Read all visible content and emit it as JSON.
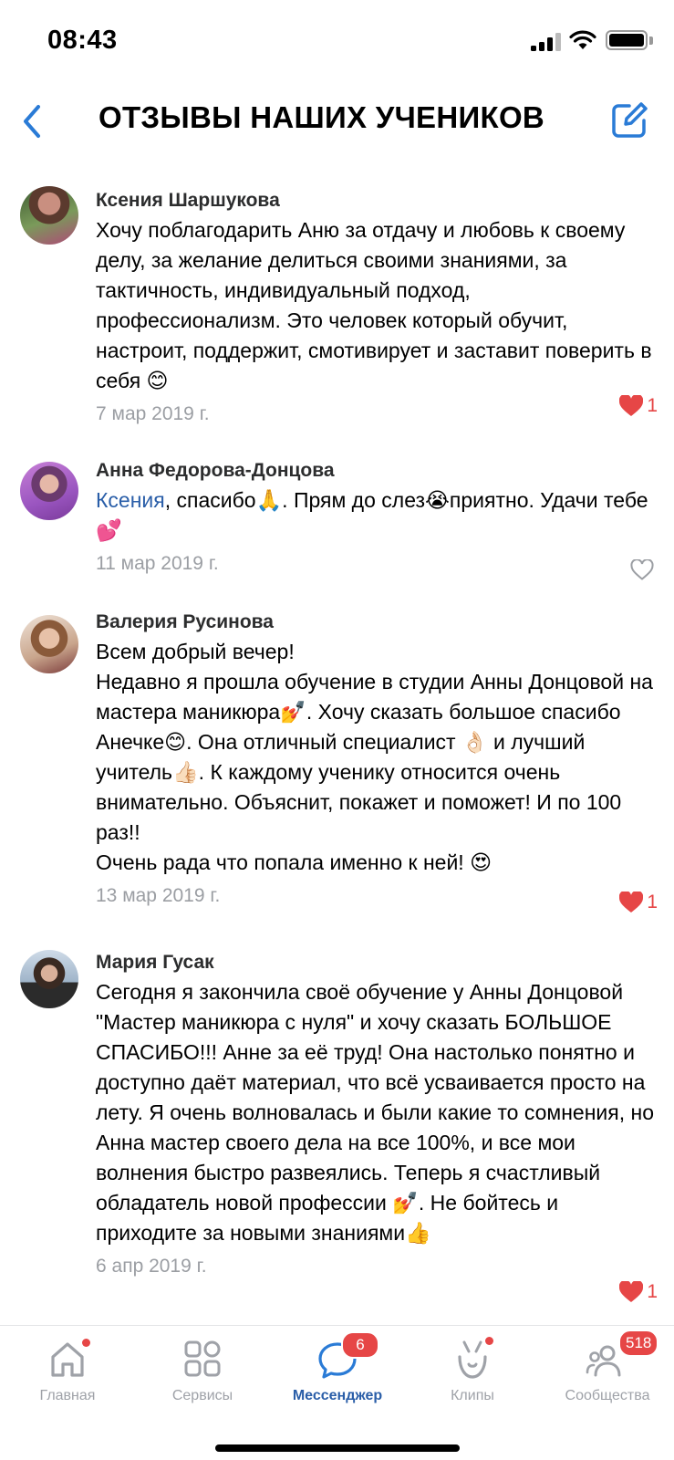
{
  "status_bar": {
    "time": "08:43"
  },
  "header": {
    "title": "ОТЗЫВЫ НАШИХ УЧЕНИКОВ",
    "back_icon": "chevron-left-icon",
    "edit_icon": "edit-icon"
  },
  "comments": [
    {
      "author": "Ксения Шаршукова",
      "text": "Хочу поблагодарить Аню за отдачу и любовь к своему делу, за желание делиться своими знаниями, за тактичность, индивидуальный подход, профессионализм. Это человек который обучит, настроит, поддержит, смотивирует и заставит поверить в себя 😊",
      "date": "7 мар 2019 г.",
      "likes": "1",
      "liked": true
    },
    {
      "author": "Анна Федорова-Донцова",
      "mention": "Ксения",
      "text": ", спасибо🙏. Прям до слез😭приятно. Удачи тебе💕",
      "date": "11 мар 2019 г.",
      "likes": "",
      "liked": false
    },
    {
      "author": "Валерия Русинова",
      "text": "Всем добрый вечер!\nНедавно я прошла обучение в студии Анны Донцовой на мастера маникюра💅. Хочу сказать большое спасибо Анечке😊. Она отличный специалист 👌🏻 и лучший учитель👍🏻. К каждому ученику относится очень внимательно. Объяснит, покажет и поможет! И по 100 раз!!\nОчень рада что попала именно к ней! 😍",
      "date": "13 мар 2019 г.",
      "likes": "1",
      "liked": true
    },
    {
      "author": "Мария Гусак",
      "text": "Сегодня я закончила своё обучение у Анны Донцовой \"Мастер маникюра с нуля\" и хочу сказать БОЛЬШОЕ СПАСИБО!!! Анне за её труд! Она настолько понятно и доступно даёт материал, что всё усваивается просто на лету. Я очень волновалась и были какие то сомнения, но Анна мастер своего дела на все 100%, и все мои волнения быстро развеялись. Теперь я счастливый обладатель новой профессии 💅. Не бойтесь и приходите за новыми знаниями👍",
      "date": "6 апр 2019 г.",
      "likes": "1",
      "liked": true
    }
  ],
  "tabbar": {
    "tabs": [
      {
        "label": "Главная",
        "icon": "home-icon"
      },
      {
        "label": "Сервисы",
        "icon": "services-grid-icon"
      },
      {
        "label": "Мессенджер",
        "icon": "messenger-icon",
        "badge": "6"
      },
      {
        "label": "Клипы",
        "icon": "clips-icon"
      },
      {
        "label": "Сообщества",
        "icon": "communities-icon",
        "badge": "518"
      }
    ]
  },
  "colors": {
    "accent": "#2a5ea8",
    "like_red": "#e64646",
    "muted": "#9b9ea3"
  }
}
